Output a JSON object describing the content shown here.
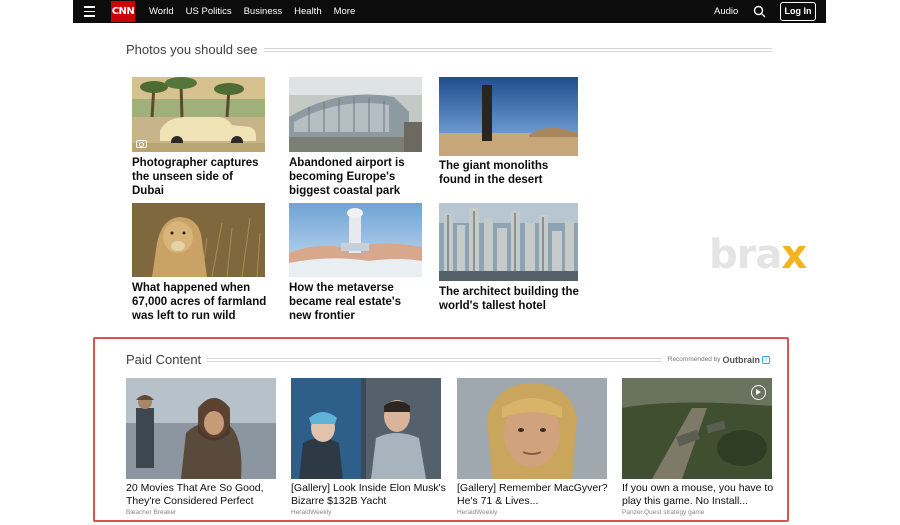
{
  "nav": {
    "logo": "CNN",
    "items": [
      "World",
      "US Politics",
      "Business",
      "Health",
      "More"
    ],
    "audio": "Audio",
    "login": "Log In"
  },
  "photos": {
    "title": "Photos you should see",
    "cards": [
      {
        "caption": "Photographer captures the unseen side of Dubai"
      },
      {
        "caption": "Abandoned airport is becoming Europe's biggest coastal park"
      },
      {
        "caption": "The giant monoliths found in the desert"
      },
      {
        "caption": "What happened when 67,000 acres of farmland was left to run wild"
      },
      {
        "caption": "How the metaverse became real estate's new frontier"
      },
      {
        "caption": "The architect building the world's tallest hotel"
      }
    ]
  },
  "watermark": {
    "text": "bra",
    "x": "x"
  },
  "paid": {
    "title": "Paid Content",
    "recommended_by": "Recommended by",
    "outbrain": "Outbrain",
    "cards": [
      {
        "title": "20 Movies That Are So Good, They're Considered Perfect",
        "source": "Bleacher Breaker"
      },
      {
        "title": "[Gallery] Look Inside Elon Musk's Bizarre $132B Yacht",
        "source": "HeraldWeekly"
      },
      {
        "title": "[Gallery] Remember MacGyver? He's 71 & Lives...",
        "source": "HeraldWeekly"
      },
      {
        "title": "If you own a mouse, you have to play this game. No Install...",
        "source": "Panzer.Quest strategy game"
      }
    ]
  },
  "colors": {
    "nav_bg": "#0c0c0c",
    "brand": "#cc0000",
    "paid_border": "#d9534f",
    "watermark_accent": "#f4b31b"
  }
}
